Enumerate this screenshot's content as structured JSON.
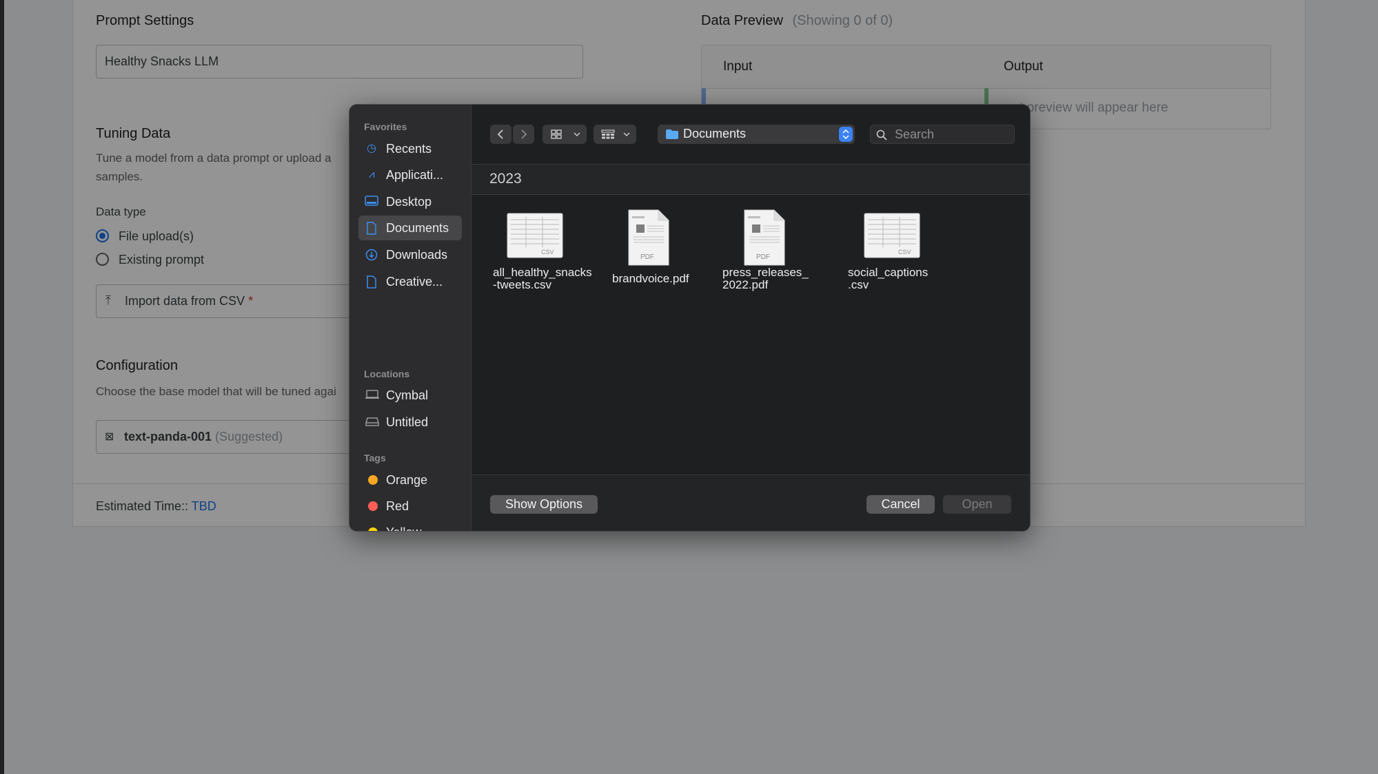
{
  "background": {
    "prompt_settings": {
      "title": "Prompt Settings",
      "name_value": "Healthy Snacks LLM"
    },
    "data_preview": {
      "title": "Data Preview",
      "showing": "(Showing 0 of 0)",
      "col_input": "Input",
      "col_output": "Output",
      "empty_text": "out preview will appear here"
    },
    "tuning_data": {
      "title": "Tuning Data",
      "desc_line1": "Tune a model from a data prompt or upload a",
      "desc_line2": "samples.",
      "data_type_label": "Data type",
      "option_file": "File upload(s)",
      "option_existing": "Existing prompt",
      "import_label": "Import data from CSV",
      "required_mark": "*"
    },
    "configuration": {
      "title": "Configuration",
      "desc": "Choose the base model that will be tuned agai",
      "model_name": "text-panda-001",
      "model_suggested": "(Suggested)"
    },
    "footer": {
      "estimated_label": "Estimated Time::",
      "estimated_value": "TBD"
    }
  },
  "dialog": {
    "sidebar": {
      "favorites_label": "Favorites",
      "favorites": [
        {
          "label": "Recents",
          "icon": "clock-icon"
        },
        {
          "label": "Applicati...",
          "icon": "applications-icon"
        },
        {
          "label": "Desktop",
          "icon": "desktop-icon"
        },
        {
          "label": "Documents",
          "icon": "document-icon",
          "selected": true
        },
        {
          "label": "Downloads",
          "icon": "download-icon"
        },
        {
          "label": "Creative...",
          "icon": "document-icon"
        }
      ],
      "locations_label": "Locations",
      "locations": [
        {
          "label": "Cymbal",
          "icon": "laptop-icon"
        },
        {
          "label": "Untitled",
          "icon": "drive-icon"
        }
      ],
      "tags_label": "Tags",
      "tags": [
        {
          "label": "Orange",
          "color": "#f5a623"
        },
        {
          "label": "Red",
          "color": "#ff5f57"
        },
        {
          "label": "Yellow",
          "color": "#ffd60a"
        }
      ]
    },
    "toolbar": {
      "location": "Documents",
      "search_placeholder": "Search"
    },
    "group_header": "2023",
    "files": [
      {
        "line1": "all_healthy_snacks",
        "line2": "-tweets.csv",
        "type": "CSV"
      },
      {
        "line1": "brandvoice.pdf",
        "line2": "",
        "type": "PDF"
      },
      {
        "line1": "press_releases_",
        "line2": "2022.pdf",
        "type": "PDF"
      },
      {
        "line1": "social_captions",
        "line2": ".csv",
        "type": "CSV"
      }
    ],
    "buttons": {
      "show_options": "Show Options",
      "cancel": "Cancel",
      "open": "Open"
    }
  }
}
